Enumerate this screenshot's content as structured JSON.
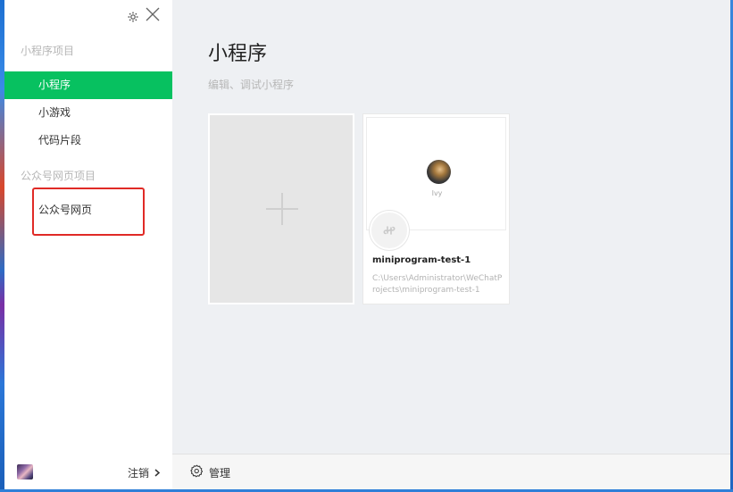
{
  "sidebar": {
    "section_miniprogram": "小程序项目",
    "items": [
      {
        "label": "小程序",
        "active": true
      },
      {
        "label": "小游戏",
        "active": false
      },
      {
        "label": "代码片段",
        "active": false
      }
    ],
    "section_official": "公众号网页项目",
    "official_items": [
      {
        "label": "公众号网页"
      }
    ],
    "footer": {
      "logout_label": "注销"
    }
  },
  "main": {
    "title": "小程序",
    "subtitle": "编辑、调试小程序",
    "project": {
      "owner": "Ivy",
      "name": "miniprogram-test-1",
      "path": "C:\\Users\\Administrator\\WeChatProjects\\miniprogram-test-1"
    }
  },
  "bottom_bar": {
    "manage_label": "管理"
  },
  "colors": {
    "accent": "#07c160",
    "highlight_border": "#e02a26"
  },
  "icons": {
    "settings": "gear-icon",
    "close": "close-icon",
    "add": "plus-icon",
    "miniprogram": "miniprogram-logo-icon",
    "chevron": "chevron-right-icon"
  }
}
